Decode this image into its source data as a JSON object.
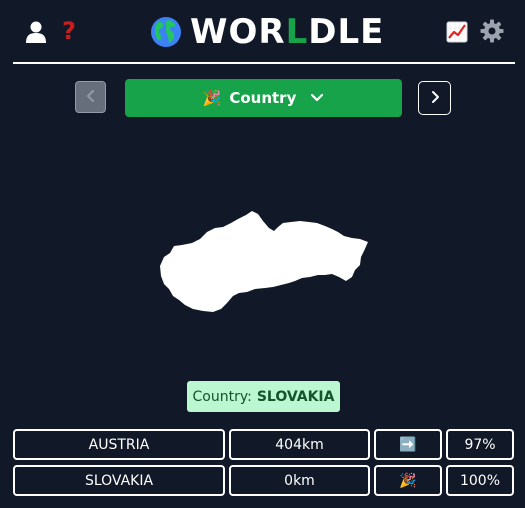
{
  "header": {
    "title_prefix": "WOR",
    "title_accent": "L",
    "title_suffix": "DLE",
    "help_symbol": "?",
    "icons": [
      "user-icon",
      "help-icon",
      "globe-icon",
      "stats-icon",
      "gear-icon"
    ]
  },
  "nav": {
    "mode_emoji": "🎉",
    "mode_label": "Country",
    "prev_icon": "chevron-left-icon",
    "next_icon": "chevron-right-icon"
  },
  "answer": {
    "prefix": "Country:",
    "value": "SLOVAKIA"
  },
  "guesses": [
    {
      "name": "AUSTRIA",
      "distance": "404km",
      "direction": "➡️",
      "proximity": "97%"
    },
    {
      "name": "SLOVAKIA",
      "distance": "0km",
      "direction": "🎉",
      "proximity": "100%"
    }
  ],
  "colors": {
    "background": "#111827",
    "accent": "#16a34a",
    "answer_bg": "#bbf7d0",
    "help": "#c81e1e"
  }
}
